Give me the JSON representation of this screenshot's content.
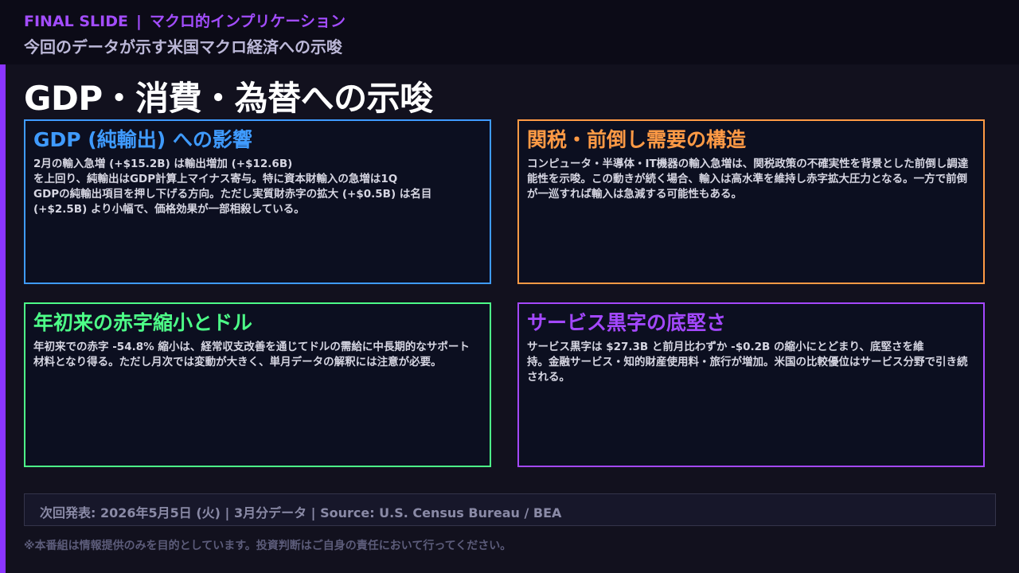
{
  "header": {
    "kicker_left": "FINAL SLIDE",
    "kicker_sep": "|",
    "kicker_right": "マクロ的インプリケーション",
    "subtitle": "今回のデータが示す米国マクロ経済への示唆"
  },
  "slide": {
    "title": "GDP・消費・為替への示唆"
  },
  "cards": [
    {
      "title": "GDP (純輸出) への影響",
      "body": "2月の輸入急増 (+$15.2B) は輸出増加 (+$12.6B)\nを上回り、純輸出はGDP計算上マイナス寄与。特に資本財輸入の急増は1Q\nGDPの純輸出項目を押し下げる方向。ただし実質財赤字の拡大 (+$0.5B) は名目\n(+$2.5B) より小幅で、価格効果が一部相殺している。",
      "color": "#3f9bff"
    },
    {
      "title": "関税・前倒し需要の構造",
      "body": "コンピュータ・半導体・IT機器の輸入急増は、関税政策の不確実性を背景とした前倒し調達\n能性を示唆。この動きが続く場合、輸入は高水準を維持し赤字拡大圧力となる。一方で前倒\nが一巡すれば輸入は急減する可能性もある。",
      "color": "#ff9a45"
    },
    {
      "title": "年初来の赤字縮小とドル",
      "body": "年初来での赤字 -54.8% 縮小は、経常収支改善を通じてドルの需給に中長期的なサポート\n材料となり得る。ただし月次では変動が大きく、単月データの解釈には注意が必要。",
      "color": "#4dff88"
    },
    {
      "title": "サービス黒字の底堅さ",
      "body": "サービス黒字は $27.3B と前月比わずか -$0.2B の縮小にとどまり、底堅さを維\n持。金融サービス・知的財産使用料・旅行が増加。米国の比較優位はサービス分野で引き続\nされる。",
      "color": "#a448ff"
    }
  ],
  "footer": {
    "release_info": "次回発表: 2026年5月5日 (火)  |  3月分データ  |  Source: U.S. Census Bureau / BEA",
    "disclaimer": "※本番組は情報提供のみを目的としています。投資判断はご自身の責任において行ってください。"
  },
  "colors": {
    "background": "#12111e",
    "accent_purple": "#8b35ff",
    "kicker": "#a34dff"
  }
}
